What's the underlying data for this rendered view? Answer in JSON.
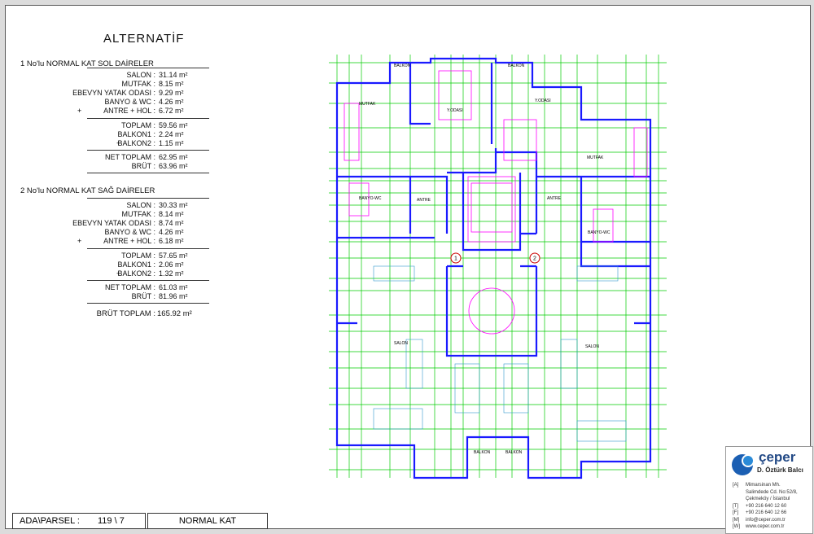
{
  "title": "ALTERNATİF",
  "sol": {
    "heading": "1  No'lu NORMAL KAT SOL DAİRELER",
    "rows": [
      {
        "label": "SALON :",
        "value": "31.14 m²"
      },
      {
        "label": "MUTFAK :",
        "value": "8.15 m²"
      },
      {
        "label": "EBEVYN YATAK ODASI :",
        "value": "9.29 m²"
      },
      {
        "label": "BANYO & WC :",
        "value": "4.26 m²"
      },
      {
        "label": "ANTRE + HOL :",
        "value": "6.72 m²"
      }
    ],
    "toplam": {
      "label": "TOPLAM :",
      "value": "59.56 m²"
    },
    "balkon1": {
      "label": "BALKON1 :",
      "value": "2.24 m²"
    },
    "balkon2": {
      "label": "BALKON2 :",
      "value": "1.15 m²"
    },
    "net": {
      "label": "NET TOPLAM :",
      "value": "62.95 m²"
    },
    "brut": {
      "label": "BRÜT :",
      "value": "63.96 m²"
    }
  },
  "sag": {
    "heading": "2  No'lu NORMAL KAT SAĞ DAİRELER",
    "rows": [
      {
        "label": "SALON :",
        "value": "30.33 m²"
      },
      {
        "label": "MUTFAK :",
        "value": "8.14 m²"
      },
      {
        "label": "EBEVYN YATAK ODASI :",
        "value": "8.74 m²"
      },
      {
        "label": "BANYO & WC :",
        "value": "4.26 m²"
      },
      {
        "label": "ANTRE + HOL :",
        "value": "6.18 m²"
      }
    ],
    "toplam": {
      "label": "TOPLAM :",
      "value": "57.65 m²"
    },
    "balkon1": {
      "label": "BALKON1 :",
      "value": "2.06 m²"
    },
    "balkon2": {
      "label": "BALKON2 :",
      "value": "1.32 m²"
    },
    "net": {
      "label": "NET TOPLAM :",
      "value": "61.03 m²"
    },
    "brut": {
      "label": "BRÜT :",
      "value": "81.96 m²"
    }
  },
  "brut_toplam": {
    "label": "BRÜT TOPLAM :",
    "value": "165.92 m²"
  },
  "plus_sign": "+",
  "plan": {
    "rooms": [
      "BALKON",
      "BALKON",
      "Y.ODASI",
      "Y.ODASI",
      "MUTFAK",
      "MUTFAK",
      "BANYO-WC",
      "ANTRE",
      "ANTRE",
      "BANYO-WC",
      "SALON",
      "SALON",
      "BALKON",
      "BALKON"
    ],
    "flat_numbers": [
      "1",
      "2"
    ],
    "colors": {
      "wall": "#1a1aff",
      "grid": "#00cc00",
      "fixture": "#ff00ff",
      "note": "#cc0000"
    }
  },
  "footer": {
    "ada_label": "ADA\\PARSEL :",
    "ada_value": "119 \\ 7",
    "floor": "NORMAL KAT"
  },
  "company": {
    "name": "çeper",
    "sub": "D. Öztürk Balcı",
    "lines": [
      {
        "k": "[A]",
        "v": "Mimarsinan Mh."
      },
      {
        "k": "",
        "v": "Salimdede Cd. No:52/8,"
      },
      {
        "k": "",
        "v": "Çekmeköy / İstanbul"
      },
      {
        "k": "[T]",
        "v": "+90 216 640 12 60"
      },
      {
        "k": "[F]",
        "v": "+90 216 640 12 66"
      },
      {
        "k": "[M]",
        "v": "info@ceper.com.tr"
      },
      {
        "k": "[W]",
        "v": "www.ceper.com.tr"
      }
    ]
  }
}
